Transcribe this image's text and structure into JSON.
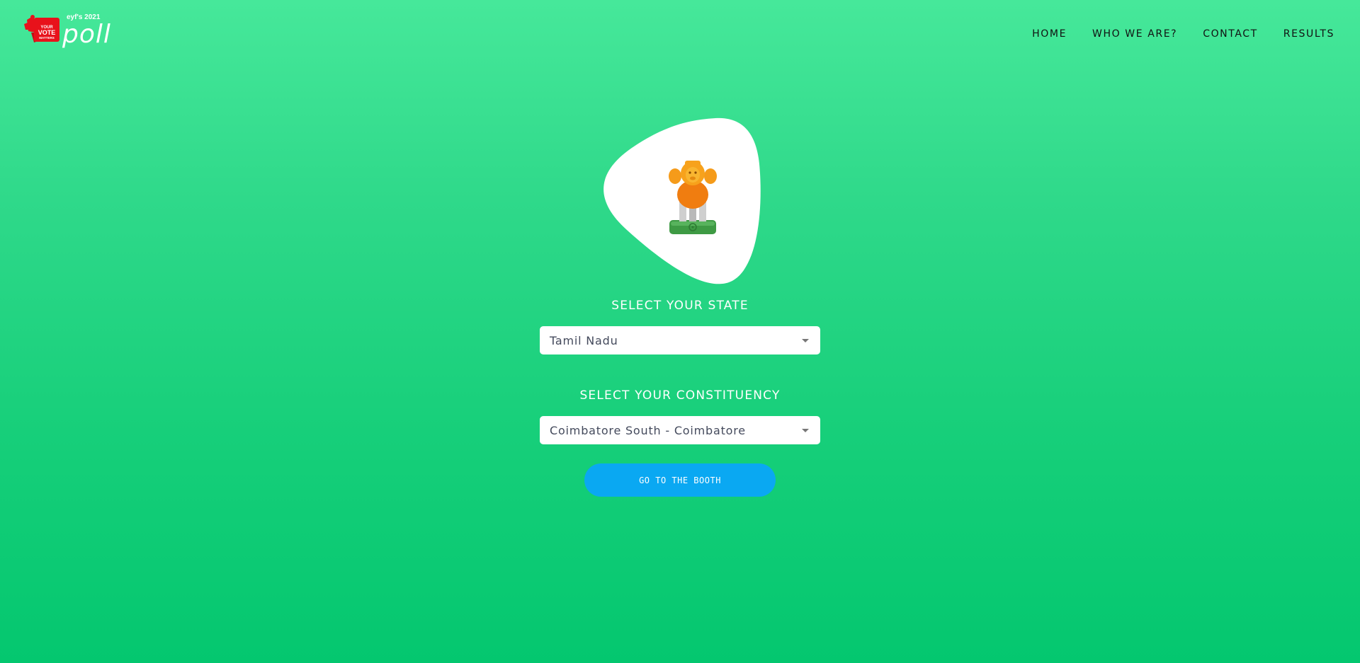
{
  "logo": {
    "tagline": "eyf's 2021",
    "wordmark": "poll",
    "badge_line1": "YOUR",
    "badge_line2": "VOTE",
    "badge_line3": "MATTERS",
    "badge_color": "#e8121b"
  },
  "nav": {
    "items": [
      {
        "label": "HOME"
      },
      {
        "label": "WHO WE ARE?"
      },
      {
        "label": "CONTACT"
      },
      {
        "label": "RESULTS"
      }
    ]
  },
  "emblem": {
    "icon": "national-emblem-lion-capital"
  },
  "state": {
    "label": "SELECT YOUR STATE",
    "selected": "Tamil Nadu"
  },
  "constituency": {
    "label": "SELECT YOUR CONSTITUENCY",
    "selected": "Coimbatore South - Coimbatore"
  },
  "cta": {
    "label": "GO TO THE BOOTH",
    "color": "#0aa8f2"
  },
  "colors": {
    "gradient_top": "#46e89a",
    "gradient_bottom": "#04c76f"
  }
}
